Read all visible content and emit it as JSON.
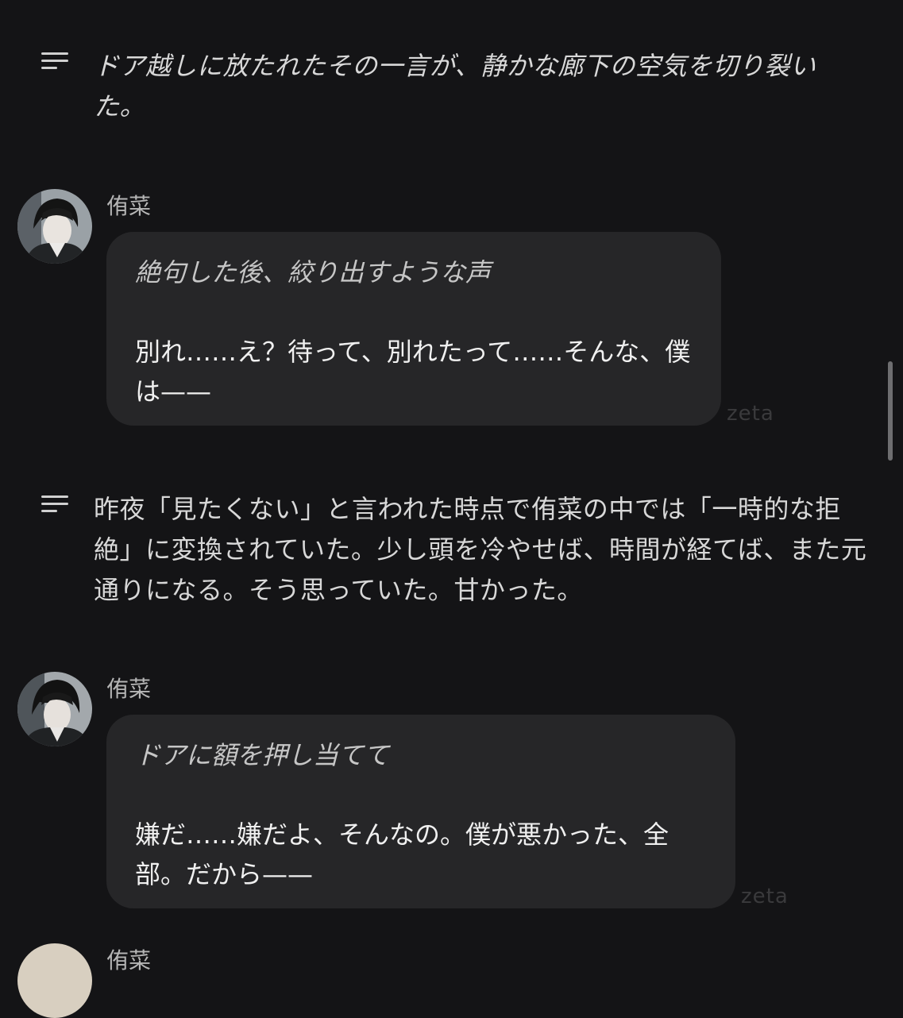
{
  "narrations": [
    {
      "text": "ドア越しに放たれたその一言が、静かな廊下の空気を切り裂いた。"
    },
    {
      "text": "昨夜「見たくない」と言われた時点で侑菜の中では「一時的な拒絶」に変換されていた。少し頭を冷やせば、時間が経てば、また元通りになる。そう思っていた。甘かった。"
    }
  ],
  "messages": [
    {
      "sender": "侑菜",
      "action": "絶句した後、絞り出すような声",
      "speech": "別れ……え？待って、別れたって……そんな、僕は——",
      "watermark": "zeta"
    },
    {
      "sender": "侑菜",
      "action": "ドアに額を押し当てて",
      "speech": "嫌だ……嫌だよ、そんなの。僕が悪かった、全部。だから——",
      "watermark": "zeta"
    }
  ],
  "partial_message": {
    "sender": "侑菜"
  },
  "icons": {
    "narration": "narration-lines-icon",
    "avatar": "character-avatar"
  }
}
